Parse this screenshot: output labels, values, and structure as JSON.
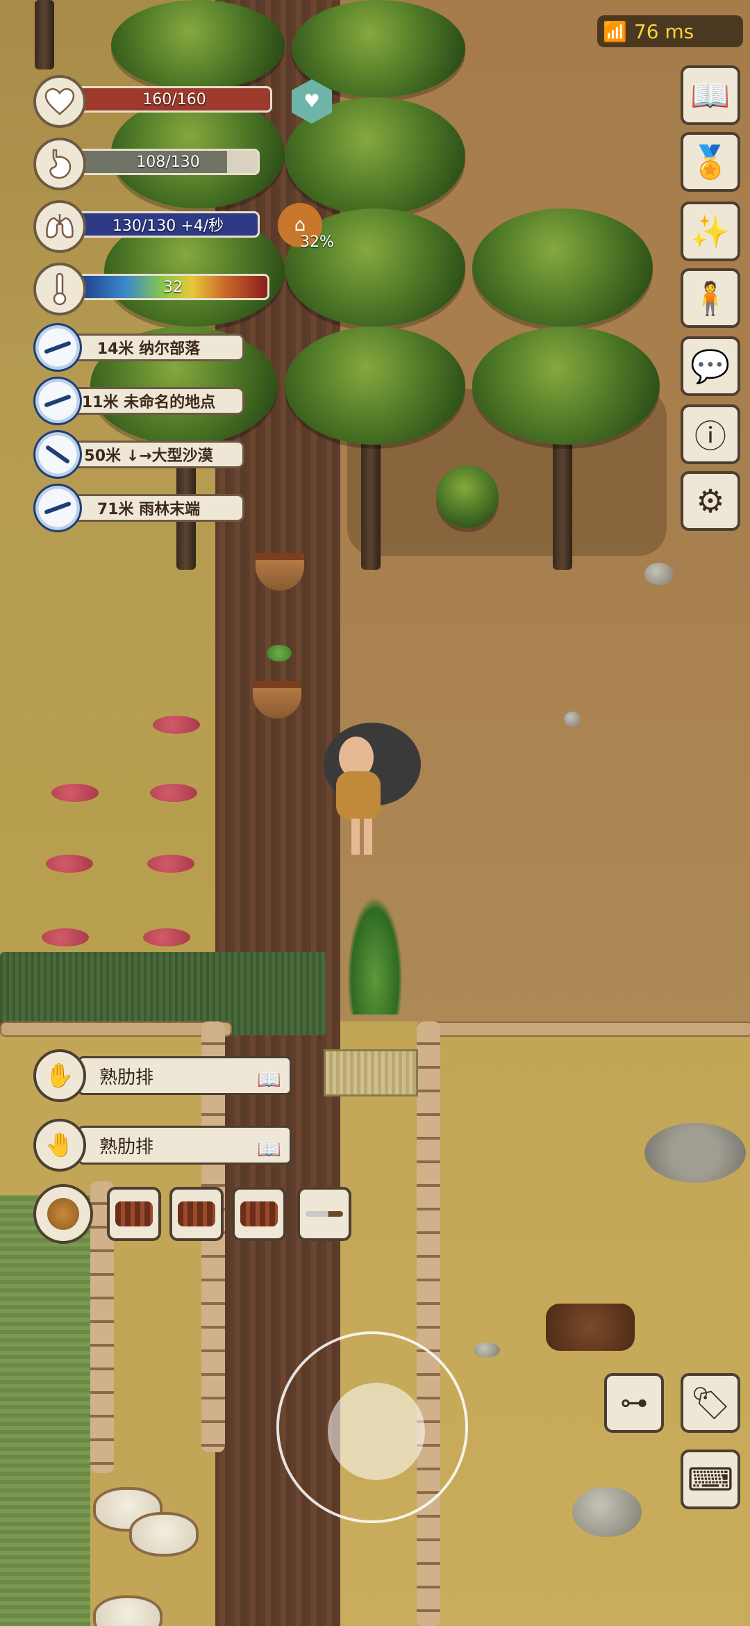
{
  "hud": {
    "health": {
      "text": "160/160",
      "value": 1.0,
      "color": "#9d3a2c"
    },
    "hunger": {
      "text": "108/130",
      "value": 0.83,
      "color": "#6f7466"
    },
    "stamina": {
      "text": "130/130 +4/秒",
      "value": 1.0,
      "color": "#2e3a86"
    },
    "temperature": {
      "text": "32"
    },
    "lungs_badge": {
      "text": "32%"
    },
    "ping": {
      "text": "76 ms"
    }
  },
  "destinations": [
    {
      "label": "14米 纳尔部落"
    },
    {
      "label": "11米 未命名的地点"
    },
    {
      "label": "50米 ↓→大型沙漠"
    },
    {
      "label": "71米 雨林末端"
    }
  ],
  "hands": {
    "left": {
      "label": "熟肋排"
    },
    "right": {
      "label": "熟肋排"
    }
  },
  "right_menu": [
    {
      "icon": "book-icon"
    },
    {
      "icon": "medal-icon"
    },
    {
      "icon": "sparkle-hands-icon"
    },
    {
      "icon": "character-upgrade-icon"
    },
    {
      "icon": "chat-bubble-icon"
    },
    {
      "icon": "info-icon"
    },
    {
      "icon": "gear-icon"
    }
  ],
  "inventory": [
    "roasted-ribs",
    "roasted-ribs",
    "roasted-ribs",
    "knife"
  ],
  "colors": {
    "accent": "#4d3f30",
    "panel": "#efe7d6",
    "ping_text": "#f6d43a"
  }
}
